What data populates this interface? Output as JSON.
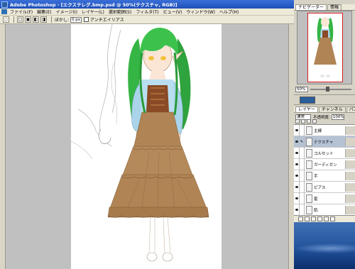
{
  "window": {
    "title": "Adobe Photoshop - [エクステレグ.bmp.psd @ 50%(テクスチャ, RGB)]",
    "controls": [
      "_",
      "□",
      "×"
    ]
  },
  "menu": [
    "ファイル(F)",
    "編集(E)",
    "イメージ(I)",
    "レイヤー(L)",
    "選択範囲(S)",
    "フィルタ(T)",
    "ビュー(V)",
    "ウィンドウ(W)",
    "ヘルプ(H)"
  ],
  "options_bar": {
    "feather_label": "ぼかし:",
    "feather_value": "0 px",
    "antialias_label": "アンチエイリアス"
  },
  "navigator": {
    "tabs": [
      "ナビゲーター",
      "情報"
    ],
    "zoom_value": "50%"
  },
  "layers_panel": {
    "tabs": [
      "レイヤー",
      "チャンネル",
      "パス"
    ],
    "blend_mode": "通常",
    "opacity_label": "不透明度:",
    "opacity_value": "100%",
    "layers": [
      {
        "name": "主線",
        "visible": true,
        "selected": false
      },
      {
        "name": "テクスチャ",
        "visible": true,
        "selected": true
      },
      {
        "name": "コルセット",
        "visible": true,
        "selected": false
      },
      {
        "name": "ガーディガン",
        "visible": true,
        "selected": false
      },
      {
        "name": "手",
        "visible": true,
        "selected": false
      },
      {
        "name": "ピアス",
        "visible": true,
        "selected": false
      },
      {
        "name": "髪",
        "visible": true,
        "selected": false
      },
      {
        "name": "肌",
        "visible": true,
        "selected": false
      }
    ]
  },
  "colors": {
    "titlebar": "#1f4fb8",
    "hair": "#35b544",
    "dress": "#b08454",
    "cardigan": "#a9d4ea",
    "corset": "#8a4a26",
    "selected_layer": "#b5c2d6"
  }
}
